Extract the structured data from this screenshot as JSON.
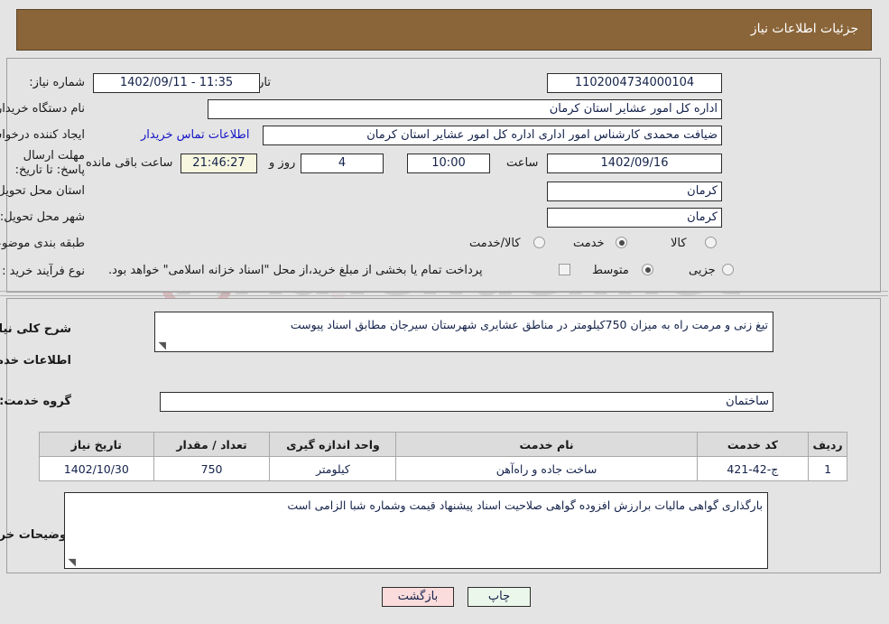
{
  "header": {
    "title": "جزئیات اطلاعات نیاز",
    "bg": "#8a6539"
  },
  "watermark": {
    "text": "AriaTender.net"
  },
  "top": {
    "need_number_label": "شماره نیاز:",
    "need_number_value": "1102004734000104",
    "announce_label": "تاریخ و ساعت اعلان عمومی:",
    "announce_value": "11:35 - 1402/09/11",
    "buyer_org_label": "نام دستگاه خریدار:",
    "buyer_org_value": "اداره کل امور عشایر استان کرمان",
    "requester_label": "ایجاد کننده درخواست:",
    "requester_value": "ضیافت محمدی کارشناس امور اداری اداره کل امور عشایر استان کرمان",
    "contact_link": "اطلاعات تماس خریدار",
    "deadline_label": "مهلت ارسال پاسخ: تا تاریخ:",
    "deadline_date": "1402/09/16",
    "hour_label": "ساعت",
    "deadline_time": "10:00",
    "days_value": "4",
    "days_unit": "روز و",
    "countdown_value": "21:46:27",
    "countdown_suffix": "ساعت باقی مانده",
    "province_label": "استان محل تحویل:",
    "province_value": "کرمان",
    "city_label": "شهر محل تحویل:",
    "city_value": "کرمان",
    "category_label": "طبقه بندی موضوعی:",
    "category_options": [
      {
        "label": "کالا",
        "selected": false
      },
      {
        "label": "خدمت",
        "selected": true
      },
      {
        "label": "کالا/خدمت",
        "selected": false
      }
    ],
    "process_label": "نوع فرآیند خرید :",
    "process_options": [
      {
        "label": "جزیی",
        "selected": false
      },
      {
        "label": "متوسط",
        "selected": true
      }
    ],
    "treasury_checkbox_checked": false,
    "treasury_text": "پرداخت تمام یا بخشی از مبلغ خرید،از محل \"اسناد خزانه اسلامی\" خواهد بود."
  },
  "mid": {
    "need_desc_label": "شرح کلی نیاز:",
    "need_desc_value": "تیغ زنی و مرمت راه به میزان 750کیلومتر در مناطق عشایری شهرستان سیرجان مطابق اسناد پیوست",
    "services_heading": "اطلاعات خدمات مورد نیاز",
    "service_group_label": "گروه خدمت:",
    "service_group_value": "ساختمان",
    "table": {
      "headers": [
        "ردیف",
        "کد خدمت",
        "نام خدمت",
        "واحد اندازه گیری",
        "تعداد / مقدار",
        "تاریخ نیاز"
      ],
      "rows": [
        [
          "1",
          "ج-42-421",
          "ساخت جاده و راه‌آهن",
          "کیلومتر",
          "750",
          "1402/10/30"
        ]
      ]
    },
    "buyer_notes_label": "توضیحات خریدار:",
    "buyer_notes_value": "بارگذاری گواهی مالیات برارزش افزوده  گواهی صلاحیت  اسناد پیشنهاد قیمت وشماره شبا الزامی است"
  },
  "footer": {
    "print_label": "چاپ",
    "back_label": "بازگشت"
  }
}
